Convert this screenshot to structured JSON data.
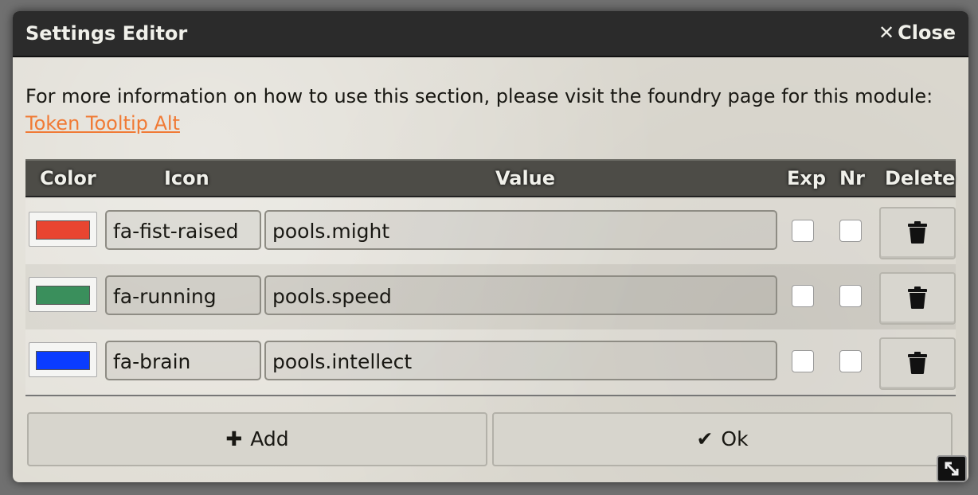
{
  "window": {
    "title": "Settings Editor",
    "close_label": "Close"
  },
  "info": {
    "text": "For more information on how to use this section, please visit the foundry page for this module:",
    "link_text": "Token Tooltip Alt",
    "link_color": "#f07a35"
  },
  "table": {
    "headers": {
      "color": "Color",
      "icon": "Icon",
      "value": "Value",
      "exp": "Exp",
      "nr": "Nr",
      "delete": "Delete"
    },
    "rows": [
      {
        "color": "#e84530",
        "icon": "fa-fist-raised",
        "value": "pools.might",
        "exp": false,
        "nr": false
      },
      {
        "color": "#3a8f5c",
        "icon": "fa-running",
        "value": "pools.speed",
        "exp": false,
        "nr": false
      },
      {
        "color": "#0a3cff",
        "icon": "fa-brain",
        "value": "pools.intellect",
        "exp": false,
        "nr": false
      }
    ]
  },
  "footer": {
    "add_label": "Add",
    "ok_label": "Ok"
  },
  "icons": {
    "close": "close-icon",
    "delete": "trash-icon",
    "add": "plus-icon",
    "ok": "check-icon",
    "resize": "resize-icon"
  }
}
